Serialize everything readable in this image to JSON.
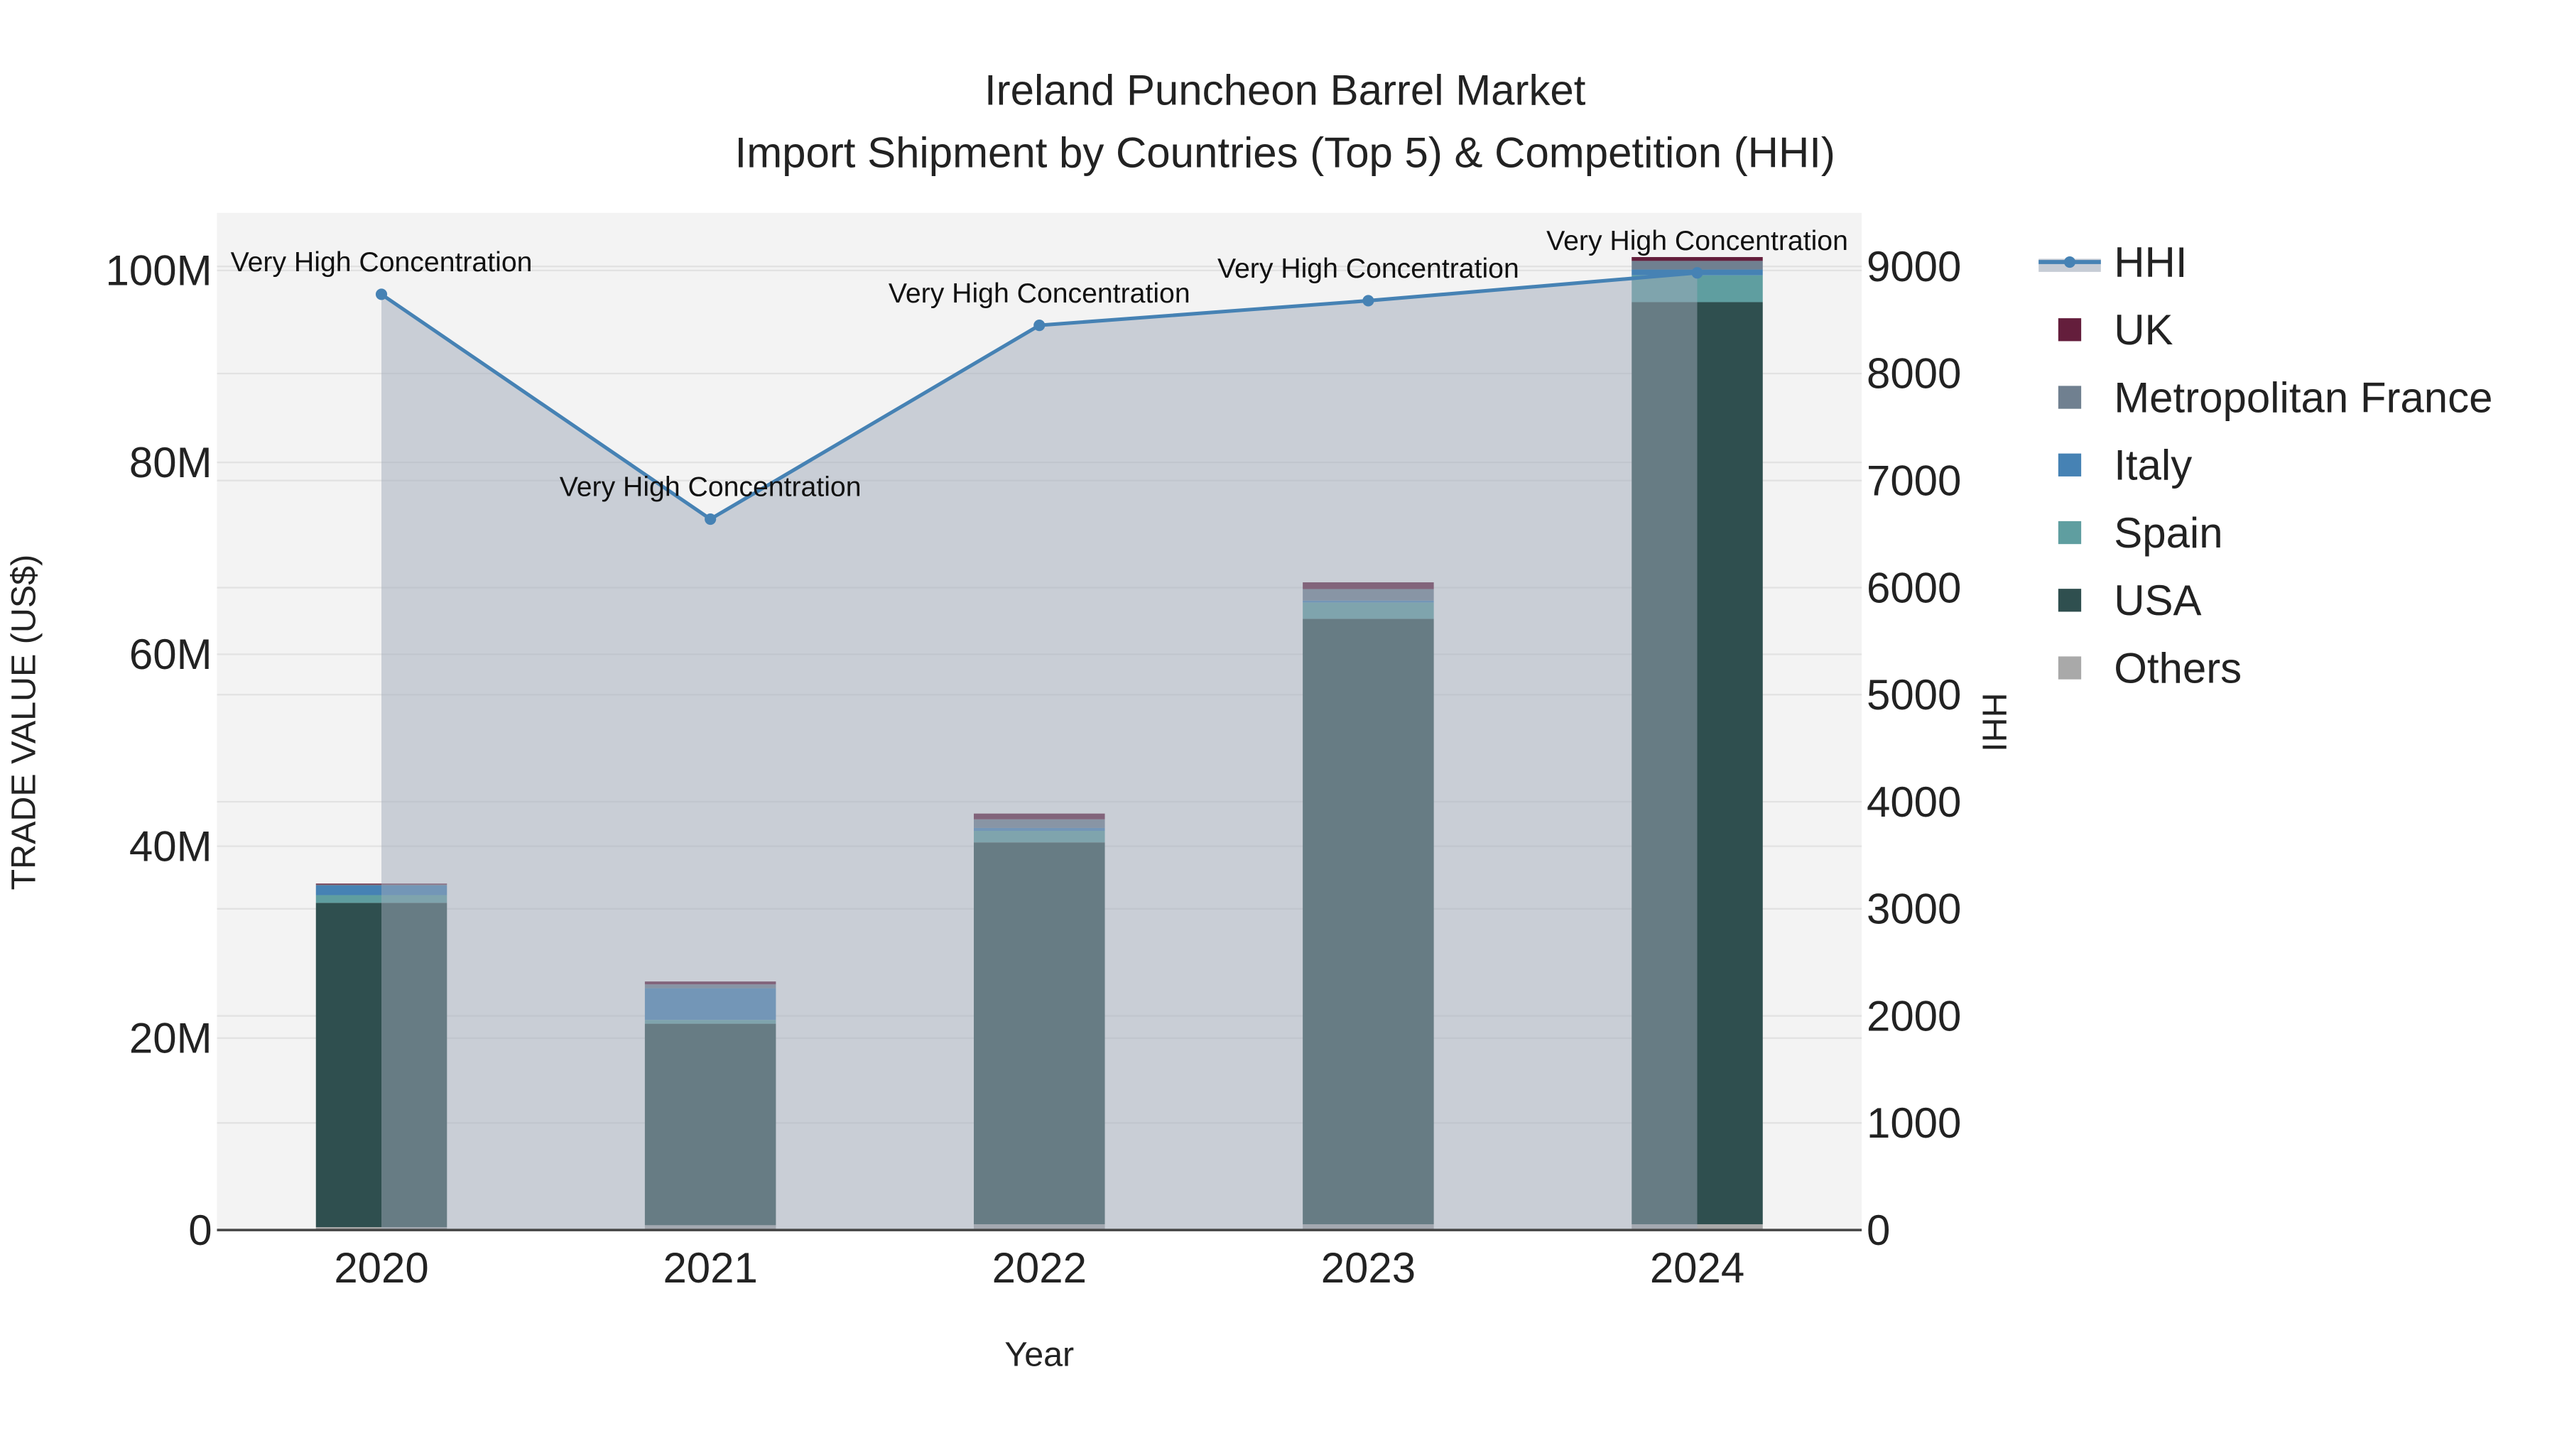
{
  "chart_data": {
    "type": "bar",
    "title": "Ireland Puncheon Barrel Market",
    "subtitle": "Import Shipment by Countries (Top 5) & Competition (HHI)",
    "xlabel": "Year",
    "ylabel": "TRADE VALUE (US$)",
    "y2label": "HHI",
    "categories": [
      "2020",
      "2021",
      "2022",
      "2023",
      "2024"
    ],
    "ylim": [
      0,
      106000000
    ],
    "y2lim": [
      0,
      9500
    ],
    "yticks": [
      {
        "v": 0,
        "label": "0"
      },
      {
        "v": 20000000,
        "label": "20M"
      },
      {
        "v": 40000000,
        "label": "40M"
      },
      {
        "v": 60000000,
        "label": "60M"
      },
      {
        "v": 80000000,
        "label": "80M"
      },
      {
        "v": 100000000,
        "label": "100M"
      }
    ],
    "y2ticks": [
      0,
      1000,
      2000,
      3000,
      4000,
      5000,
      6000,
      7000,
      8000,
      9000
    ],
    "stacked": true,
    "series": [
      {
        "name": "Others",
        "color": "#a9a9a9",
        "values": [
          300000,
          500000,
          600000,
          600000,
          600000
        ]
      },
      {
        "name": "USA",
        "color": "#2f4f4f",
        "values": [
          33800000,
          21000000,
          39800000,
          63100000,
          96100000
        ]
      },
      {
        "name": "Spain",
        "color": "#5f9ea0",
        "values": [
          800000,
          400000,
          1200000,
          1700000,
          2800000
        ]
      },
      {
        "name": "Italy",
        "color": "#4682b4",
        "values": [
          1000000,
          3300000,
          300000,
          200000,
          600000
        ]
      },
      {
        "name": "Metropolitan France",
        "color": "#708090",
        "values": [
          100000,
          400000,
          900000,
          1200000,
          900000
        ]
      },
      {
        "name": "UK",
        "color": "#641e3c",
        "values": [
          100000,
          300000,
          600000,
          700000,
          400000
        ]
      }
    ],
    "line": {
      "name": "HHI",
      "color": "#4682b4",
      "values": [
        8740,
        6640,
        8450,
        8680,
        8940
      ],
      "annotations": [
        "Very High Concentration",
        "Very High Concentration",
        "Very High Concentration",
        "Very High Concentration",
        "Very High Concentration"
      ]
    },
    "legend_order": [
      "HHI",
      "UK",
      "Metropolitan France",
      "Italy",
      "Spain",
      "USA",
      "Others"
    ],
    "legend_position": "right",
    "grid": true
  }
}
